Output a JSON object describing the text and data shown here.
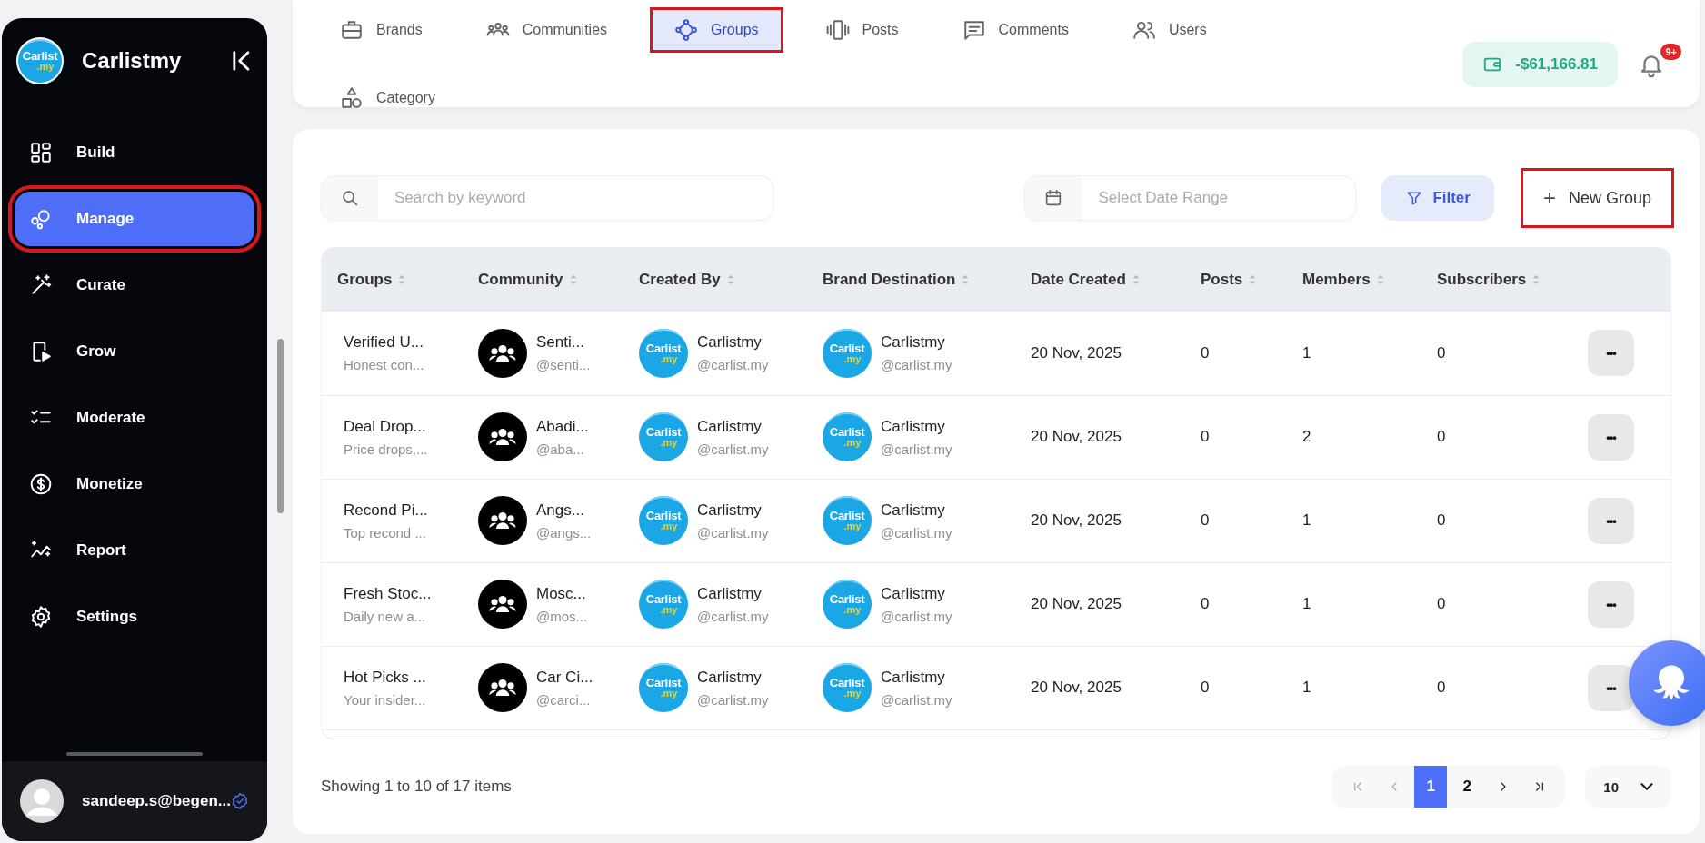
{
  "sidebar": {
    "brand": {
      "name": "Carlistmy",
      "logo_text": "Carlist",
      "logo_subtext": ".my"
    },
    "items": [
      {
        "label": "Build",
        "selected": false,
        "highlighted": false
      },
      {
        "label": "Manage",
        "selected": true,
        "highlighted": true
      },
      {
        "label": "Curate",
        "selected": false,
        "highlighted": false
      },
      {
        "label": "Grow",
        "selected": false,
        "highlighted": false
      },
      {
        "label": "Moderate",
        "selected": false,
        "highlighted": false
      },
      {
        "label": "Monetize",
        "selected": false,
        "highlighted": false
      },
      {
        "label": "Report",
        "selected": false,
        "highlighted": false
      },
      {
        "label": "Settings",
        "selected": false,
        "highlighted": false
      }
    ],
    "user": {
      "email": "sandeep.s@begen..."
    }
  },
  "top_nav": {
    "tabs": [
      {
        "label": "Brands",
        "selected": false,
        "highlighted": false
      },
      {
        "label": "Communities",
        "selected": false,
        "highlighted": false
      },
      {
        "label": "Groups",
        "selected": true,
        "highlighted": true
      },
      {
        "label": "Posts",
        "selected": false,
        "highlighted": false
      },
      {
        "label": "Comments",
        "selected": false,
        "highlighted": false
      },
      {
        "label": "Users",
        "selected": false,
        "highlighted": false
      },
      {
        "label": "Category",
        "selected": false,
        "highlighted": false
      }
    ],
    "wallet": {
      "balance": "-$61,166.81"
    },
    "notifications": {
      "badge": "9+"
    }
  },
  "toolbar": {
    "search": {
      "placeholder": "Search by keyword"
    },
    "date_range": {
      "placeholder": "Select Date Range"
    },
    "filter_button": "Filter",
    "new_button": {
      "icon_text": "+",
      "label": "New Group",
      "highlighted": true
    }
  },
  "table": {
    "columns": [
      "Groups",
      "Community",
      "Created By",
      "Brand Destination",
      "Date Created",
      "Posts",
      "Members",
      "Subscribers"
    ],
    "rows": [
      {
        "name": "Verified U...",
        "description": "Honest con...",
        "community": {
          "name": "Senti...",
          "handle": "@senti..."
        },
        "created_by": {
          "name": "Carlistmy",
          "handle": "@carlist.my",
          "logo_text": "Carlist",
          "logo_subtext": ".my"
        },
        "brand_destination": {
          "name": "Carlistmy",
          "handle": "@carlist.my",
          "logo_text": "Carlist",
          "logo_subtext": ".my"
        },
        "date_created": "20 Nov, 2025",
        "posts": "0",
        "members": "1",
        "subscribers": "0",
        "menu": "•••"
      },
      {
        "name": "Deal Drop...",
        "description": "Price drops,...",
        "community": {
          "name": "Abadi...",
          "handle": "@aba..."
        },
        "created_by": {
          "name": "Carlistmy",
          "handle": "@carlist.my",
          "logo_text": "Carlist",
          "logo_subtext": ".my"
        },
        "brand_destination": {
          "name": "Carlistmy",
          "handle": "@carlist.my",
          "logo_text": "Carlist",
          "logo_subtext": ".my"
        },
        "date_created": "20 Nov, 2025",
        "posts": "0",
        "members": "2",
        "subscribers": "0",
        "menu": "•••"
      },
      {
        "name": "Recond Pi...",
        "description": "Top recond ...",
        "community": {
          "name": "Angs...",
          "handle": "@angs..."
        },
        "created_by": {
          "name": "Carlistmy",
          "handle": "@carlist.my",
          "logo_text": "Carlist",
          "logo_subtext": ".my"
        },
        "brand_destination": {
          "name": "Carlistmy",
          "handle": "@carlist.my",
          "logo_text": "Carlist",
          "logo_subtext": ".my"
        },
        "date_created": "20 Nov, 2025",
        "posts": "0",
        "members": "1",
        "subscribers": "0",
        "menu": "•••"
      },
      {
        "name": "Fresh Stoc...",
        "description": "Daily new a...",
        "community": {
          "name": "Mosc...",
          "handle": "@mos..."
        },
        "created_by": {
          "name": "Carlistmy",
          "handle": "@carlist.my",
          "logo_text": "Carlist",
          "logo_subtext": ".my"
        },
        "brand_destination": {
          "name": "Carlistmy",
          "handle": "@carlist.my",
          "logo_text": "Carlist",
          "logo_subtext": ".my"
        },
        "date_created": "20 Nov, 2025",
        "posts": "0",
        "members": "1",
        "subscribers": "0",
        "menu": "•••"
      },
      {
        "name": "Hot Picks ...",
        "description": "Your insider...",
        "community": {
          "name": "Car Ci...",
          "handle": "@carci..."
        },
        "created_by": {
          "name": "Carlistmy",
          "handle": "@carlist.my",
          "logo_text": "Carlist",
          "logo_subtext": ".my"
        },
        "brand_destination": {
          "name": "Carlistmy",
          "handle": "@carlist.my",
          "logo_text": "Carlist",
          "logo_subtext": ".my"
        },
        "date_created": "20 Nov, 2025",
        "posts": "0",
        "members": "1",
        "subscribers": "0",
        "menu": "•••"
      }
    ]
  },
  "pagination": {
    "summary": "Showing 1 to 10 of 17 items",
    "pages": [
      {
        "label": "1",
        "selected": true
      },
      {
        "label": "2",
        "selected": false
      }
    ],
    "page_size": "10"
  }
}
